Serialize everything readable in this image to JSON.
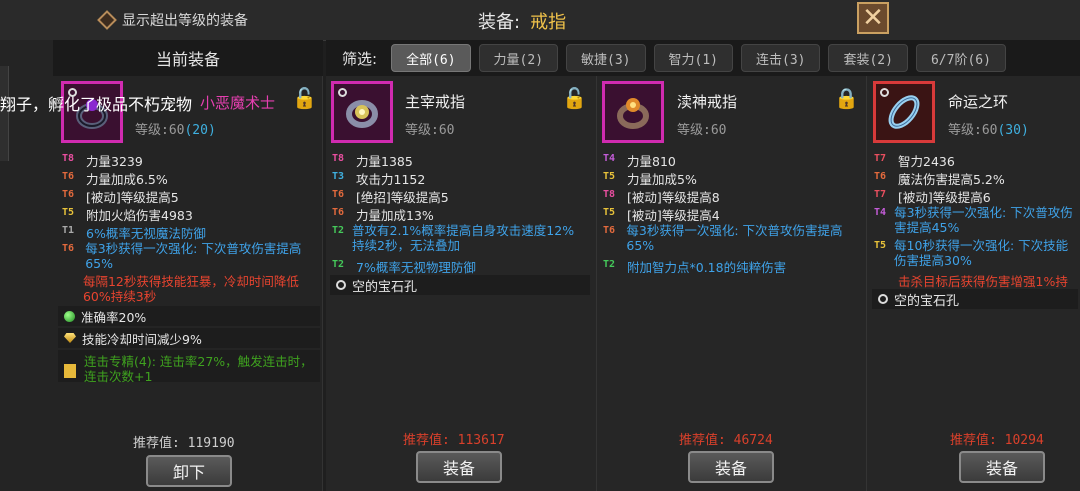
{
  "top": {
    "show_higher_label": "显示超出等级的装备",
    "title_label": "装备:",
    "title_value": "戒指",
    "close_icon": "close-x-icon"
  },
  "left": {
    "header": "当前装备",
    "overlay_text": "翔子，孵化了极品不朽宠物",
    "pet_name": "小恶魔术士",
    "level_label": "等级:60",
    "level_bonus": "(20)",
    "stats": [
      {
        "tier": "T8",
        "text": "力量3239"
      },
      {
        "tier": "T6",
        "text": "力量加成6.5%"
      },
      {
        "tier": "T6",
        "text": "[被动]等级提高5"
      },
      {
        "tier": "T5",
        "text": "附加火焰伤害4983"
      },
      {
        "tier": "T1",
        "text": "6%概率无视魔法防御"
      },
      {
        "tier": "T6",
        "text": "每3秒获得一次强化: 下次普攻伤害提高65%"
      },
      {
        "tier": "",
        "text": "每隔12秒获得技能狂暴，冷却时间降低60%持续3秒"
      }
    ],
    "gem1": "准确率20%",
    "gem2": "技能冷却时间减少9%",
    "set_text": "连击专精(4): 连击率27%，触发连击时，连击次数+1",
    "recommend": "推荐值: 119190",
    "button": "卸下"
  },
  "filter": {
    "label": "筛选:",
    "buttons": [
      "全部(6)",
      "力量(2)",
      "敏捷(3)",
      "智力(1)",
      "连击(3)",
      "套装(2)",
      "6/7阶(6)"
    ]
  },
  "cards": [
    {
      "name": "主宰戒指",
      "level": "等级:60",
      "level_bonus": "",
      "stats": [
        {
          "tier": "T8",
          "text": "力量1385"
        },
        {
          "tier": "T3",
          "text": "攻击力1152"
        },
        {
          "tier": "T6",
          "text": "[绝招]等级提高5"
        },
        {
          "tier": "T6",
          "text": "力量加成13%"
        },
        {
          "tier": "T2",
          "text": "普攻有2.1%概率提高自身攻击速度12%持续2秒，无法叠加"
        },
        {
          "tier": "T2",
          "text": "7%概率无视物理防御"
        }
      ],
      "socket": "空的宝石孔",
      "recommend": "推荐值: 113617",
      "button": "装备"
    },
    {
      "name": "渎神戒指",
      "level": "等级:60",
      "level_bonus": "",
      "stats": [
        {
          "tier": "T4",
          "text": "力量810"
        },
        {
          "tier": "T5",
          "text": "力量加成5%"
        },
        {
          "tier": "T8",
          "text": "[被动]等级提高8"
        },
        {
          "tier": "T5",
          "text": "[被动]等级提高4"
        },
        {
          "tier": "T6",
          "text": "每3秒获得一次强化: 下次普攻伤害提高65%"
        },
        {
          "tier": "T2",
          "text": "附加智力点*0.18的纯粹伤害"
        }
      ],
      "socket": "",
      "recommend": "推荐值: 46724",
      "button": "装备"
    },
    {
      "name": "命运之环",
      "level": "等级:60",
      "level_bonus": "(30)",
      "stats": [
        {
          "tier": "T7",
          "text": "智力2436"
        },
        {
          "tier": "T6",
          "text": "魔法伤害提高5.2%"
        },
        {
          "tier": "T7",
          "text": "[被动]等级提高6"
        },
        {
          "tier": "T4",
          "text": "每3秒获得一次强化: 下次普攻伤害提高45%"
        },
        {
          "tier": "T5",
          "text": "每10秒获得一次强化: 下次技能伤害提高30%"
        },
        {
          "tier": "",
          "text": "击杀目标后获得伤害增强1%持"
        }
      ],
      "socket": "空的宝石孔",
      "recommend": "推荐值: 10294",
      "button": "装备"
    }
  ]
}
